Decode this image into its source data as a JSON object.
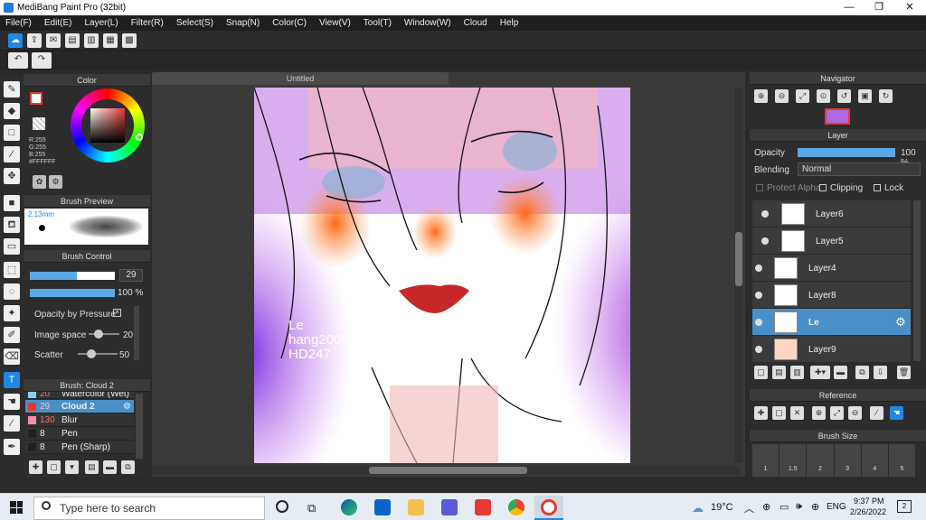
{
  "window": {
    "title": "MediBang Paint Pro (32bit)",
    "minimize": "—",
    "maximize": "❐",
    "close": "✕"
  },
  "menu": [
    "File(F)",
    "Edit(E)",
    "Layer(L)",
    "Filter(R)",
    "Select(S)",
    "Snap(N)",
    "Color(C)",
    "View(V)",
    "Tool(T)",
    "Window(W)",
    "Cloud",
    "Help"
  ],
  "color_panel": {
    "title": "Color",
    "r": "R:255",
    "g": "G:255",
    "b": "B:255",
    "hex": "#FFFFFF"
  },
  "brush_preview": {
    "title": "Brush Preview",
    "size": "2.13mm"
  },
  "brush_control": {
    "title": "Brush Control",
    "size_value": "29",
    "opacity_value": "100 %",
    "opacity_by_pressure": "Opacity by Pressure",
    "image_space_label": "Image space",
    "image_space_value": "20",
    "scatter_label": "Scatter",
    "scatter_value": "50"
  },
  "brush_panel": {
    "title": "Brush: Cloud 2",
    "items": [
      {
        "size": "20",
        "name": "Watercolor (Wet)",
        "color": "#87cefa"
      },
      {
        "size": "29",
        "name": "Cloud 2",
        "color": "#e53935"
      },
      {
        "size": "130",
        "name": "Blur",
        "color": "#f48fb1"
      },
      {
        "size": "8",
        "name": "Pen",
        "color": "#222222"
      },
      {
        "size": "8",
        "name": "Pen (Sharp)",
        "color": "#222222"
      }
    ]
  },
  "canvas": {
    "tab": "Untitled",
    "watermark_1": "Le",
    "watermark_2": "hang2008",
    "watermark_3": "HD247"
  },
  "navigator": {
    "title": "Navigator"
  },
  "layer_panel": {
    "title": "Layer",
    "opacity_label": "Opacity",
    "opacity_value": "100 %",
    "blending_label": "Blending",
    "blending_value": "Normal",
    "protect_alpha": "Protect Alpha",
    "clipping": "Clipping",
    "lock": "Lock",
    "layers": [
      "Layer6",
      "Layer5",
      "Layer4",
      "Layer8",
      "Le",
      "Layer9"
    ]
  },
  "reference_panel": {
    "title": "Reference"
  },
  "brush_size_panel": {
    "title": "Brush Size",
    "sizes": [
      "1",
      "1.5",
      "2",
      "3",
      "4",
      "5"
    ]
  },
  "taskbar": {
    "search_placeholder": "Type here to search",
    "weather": "19°C",
    "lang": "ENG",
    "time": "9:37 PM",
    "date": "2/26/2022",
    "notif": "2"
  }
}
